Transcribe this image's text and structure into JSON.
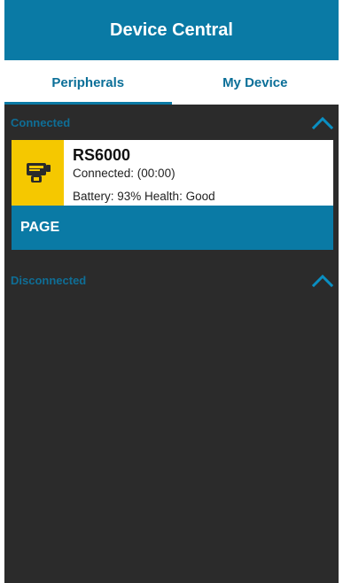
{
  "app": {
    "title": "Device Central"
  },
  "tabs": [
    {
      "label": "Peripherals",
      "active": true
    },
    {
      "label": "My Device",
      "active": false
    }
  ],
  "sections": {
    "connected": {
      "label": "Connected",
      "expanded": true,
      "devices": [
        {
          "name": "RS6000",
          "status": "Connected: (00:00)",
          "battery_health": "Battery: 93% Health: Good",
          "icon": "ring-scanner-icon",
          "action_label": "PAGE"
        }
      ]
    },
    "disconnected": {
      "label": "Disconnected",
      "expanded": true
    }
  },
  "colors": {
    "accent": "#0a7aa5",
    "background": "#2b2b2b",
    "device_icon_bg": "#f5c800",
    "section_label": "#0f6e96"
  }
}
